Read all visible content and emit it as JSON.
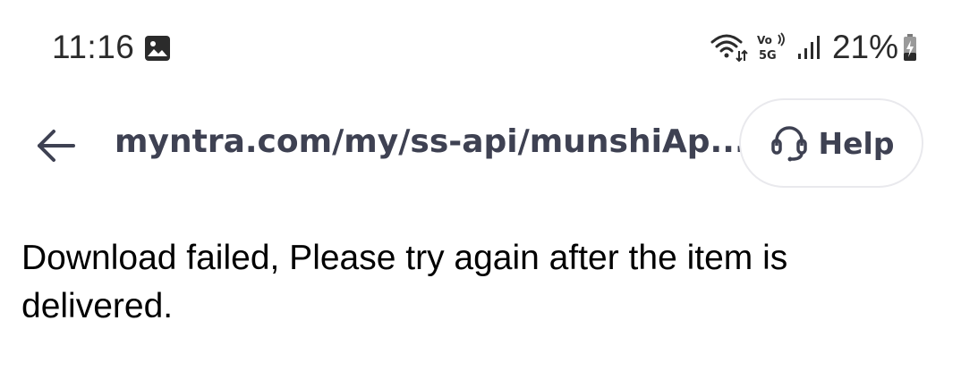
{
  "status_bar": {
    "time": "11:16",
    "battery_percent": "21%",
    "icons": [
      "gallery-icon",
      "wifi-icon",
      "volte-5g-icon",
      "signal-icon",
      "battery-charging-icon"
    ]
  },
  "app_bar": {
    "url": "myntra.com/my/ss-api/munshiAp...",
    "help_label": "Help",
    "icons": [
      "back-arrow-icon",
      "headset-icon"
    ]
  },
  "content": {
    "message": "Download failed, Please try again after the item is delivered."
  },
  "colors": {
    "text_dark": "#3e4152",
    "status_text": "#2b2b2b",
    "help_border": "#e9e9ed",
    "background": "#ffffff"
  }
}
